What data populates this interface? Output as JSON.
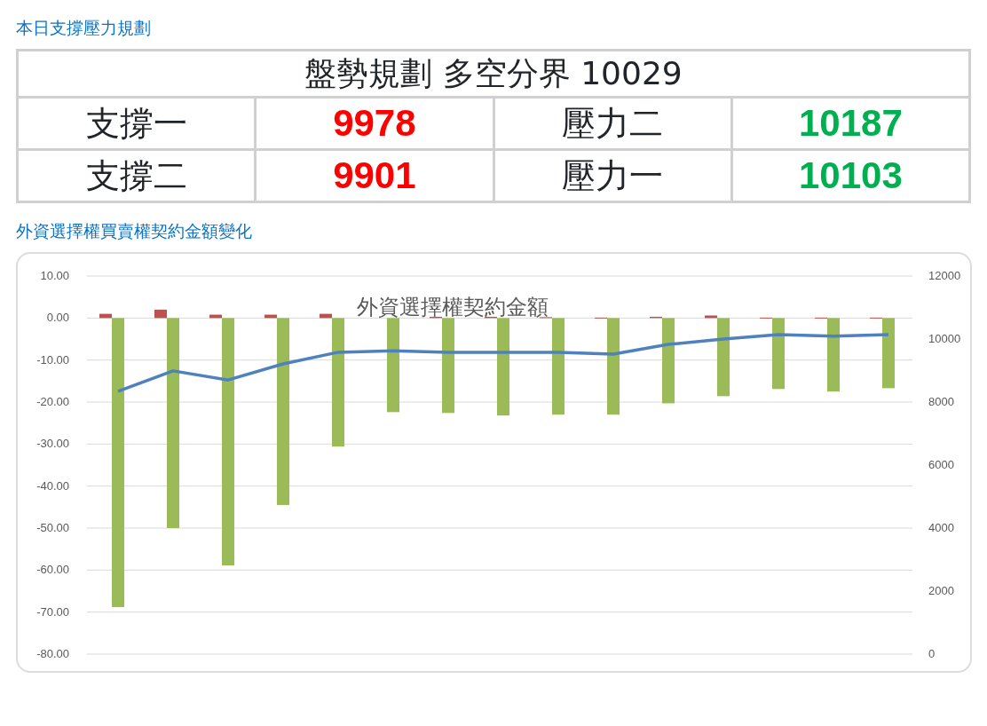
{
  "section_title": "本日支撐壓力規劃",
  "plan_table": {
    "header": "盤勢規劃 多空分界 10029",
    "rows": [
      [
        {
          "label": "支撐一",
          "value": "9978",
          "color": "#ff0000"
        },
        {
          "label": "壓力二",
          "value": "10187",
          "color": "#00b050"
        }
      ],
      [
        {
          "label": "支撐二",
          "value": "9901",
          "color": "#ff0000"
        },
        {
          "label": "壓力一",
          "value": "10103",
          "color": "#00b050"
        }
      ]
    ]
  },
  "chart_section_title": "外資選擇權買賣權契約金額變化",
  "chart": {
    "chart_data": {
      "type": "bar",
      "title": "外資選擇權契約金額",
      "grid": true,
      "ylim": [
        -80,
        10
      ],
      "yticks": [
        {
          "value": 10,
          "label": "10.00"
        },
        {
          "value": 0,
          "label": "0.00"
        },
        {
          "value": -10,
          "label": "-10.00"
        },
        {
          "value": -20,
          "label": "-20.00"
        },
        {
          "value": -30,
          "label": "-30.00"
        },
        {
          "value": -40,
          "label": "-40.00"
        },
        {
          "value": -50,
          "label": "-50.00"
        },
        {
          "value": -60,
          "label": "-60.00"
        },
        {
          "value": -70,
          "label": "-70.00"
        },
        {
          "value": -80,
          "label": "-80.00"
        }
      ],
      "y2lim": [
        0,
        12000
      ],
      "y2ticks": [
        {
          "value": 12000,
          "label": "12000"
        },
        {
          "value": 10000,
          "label": "10000"
        },
        {
          "value": 8000,
          "label": "8000"
        },
        {
          "value": 6000,
          "label": "6000"
        },
        {
          "value": 4000,
          "label": "4000"
        },
        {
          "value": 2000,
          "label": "2000"
        },
        {
          "value": 0,
          "label": "0"
        }
      ],
      "series": [
        {
          "color": "#c0504d",
          "values": [
            1.0,
            2.0,
            0.8,
            0.8,
            1.0,
            null,
            0.3,
            0.3,
            0.2,
            0.1,
            0.3,
            0.6,
            0.1,
            0.1,
            0.1
          ]
        },
        {
          "color": "#9bbb59",
          "values": [
            -68.8,
            -50.0,
            -58.9,
            -44.5,
            -30.6,
            -22.4,
            -22.6,
            -23.2,
            -23.0,
            -23.0,
            -20.3,
            -18.6,
            -16.9,
            -17.5,
            -16.7
          ]
        },
        {
          "type": "line",
          "axis": "y2",
          "color": "#4f81bd",
          "values": [
            8340,
            8990,
            8700,
            9210,
            9580,
            9630,
            9580,
            9580,
            9580,
            9520,
            9830,
            10000,
            10140,
            10090,
            10140
          ]
        }
      ]
    }
  }
}
